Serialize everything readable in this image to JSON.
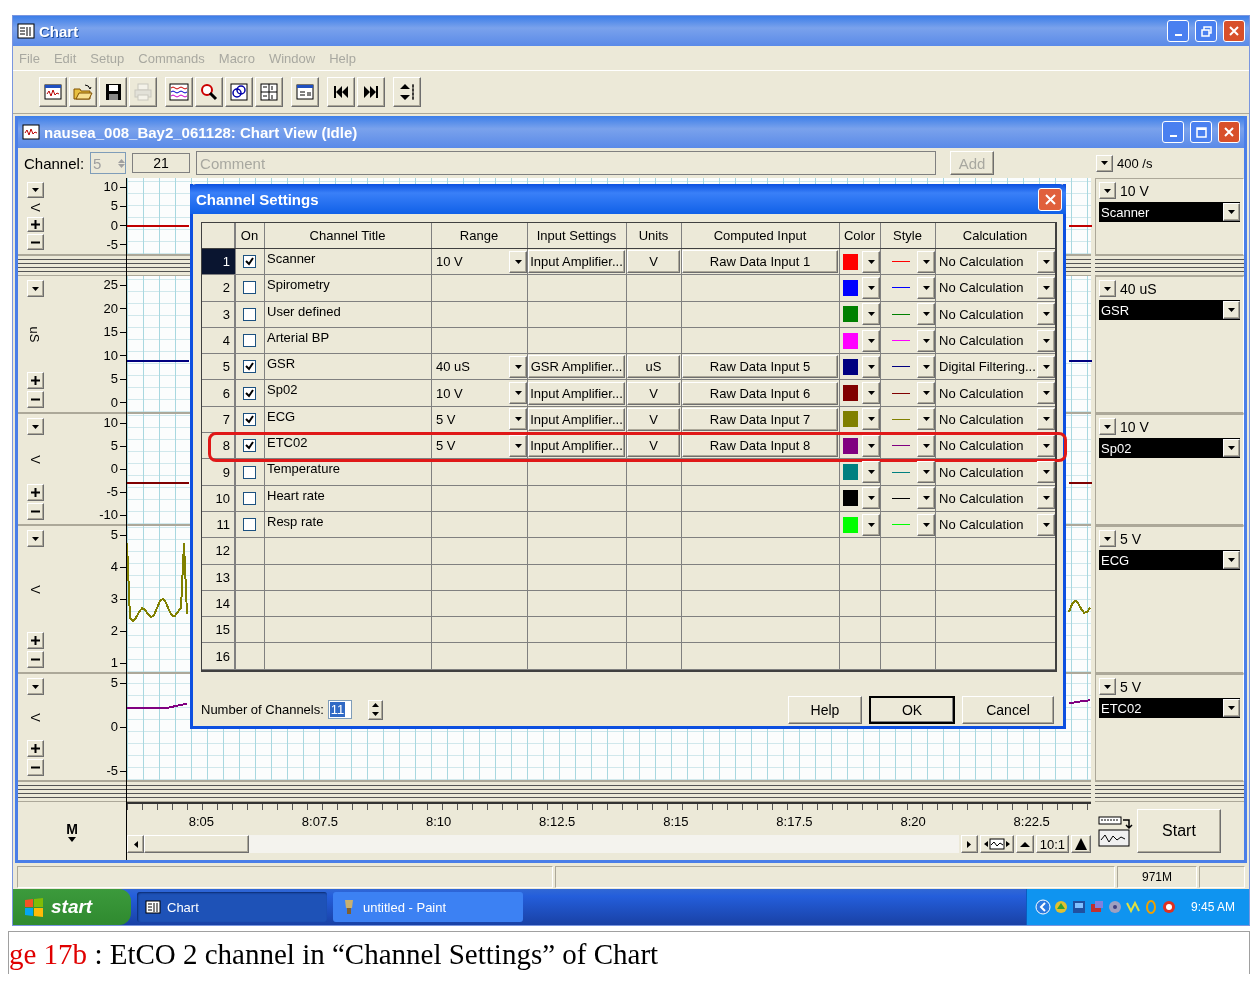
{
  "window": {
    "title": "Chart"
  },
  "menu": [
    {
      "label": "File",
      "disabled": true
    },
    {
      "label": "Edit",
      "disabled": true
    },
    {
      "label": "Setup",
      "disabled": true
    },
    {
      "label": "Commands",
      "disabled": true
    },
    {
      "label": "Macro",
      "disabled": true
    },
    {
      "label": "Window",
      "disabled": true
    },
    {
      "label": "Help",
      "disabled": true
    }
  ],
  "toolbar": [
    {
      "kind": "chart",
      "disabled": false
    },
    {
      "kind": "open",
      "disabled": false
    },
    {
      "kind": "save",
      "disabled": false
    },
    {
      "kind": "print",
      "disabled": true
    },
    {
      "kind": "display",
      "disabled": false
    },
    {
      "kind": "zoom",
      "disabled": false
    },
    {
      "kind": "scope",
      "disabled": false
    },
    {
      "kind": "table",
      "disabled": false
    },
    {
      "kind": "calc",
      "disabled": false
    },
    {
      "kind": "first",
      "disabled": false
    },
    {
      "kind": "last",
      "disabled": false
    },
    {
      "kind": "scale",
      "disabled": false
    }
  ],
  "chart_view": {
    "title": "nausea_008_Bay2_061128: Chart View (Idle)",
    "channel_label": "Channel:",
    "channel_value": "5",
    "channel_disabled": true,
    "counter": "21",
    "comment_placeholder": "Comment",
    "add_button": "Add",
    "add_disabled": true,
    "rate": "400 /s",
    "strips": [
      {
        "unit": "V",
        "ticks": [
          "10",
          "5",
          "0",
          "-5"
        ],
        "range": "10 V",
        "channel": "Scanner",
        "color": "#c00000",
        "kind": "flat"
      },
      {
        "unit": "uS",
        "ticks": [
          "25",
          "20",
          "15",
          "10",
          "5",
          "0"
        ],
        "range": "40 uS",
        "channel": "GSR",
        "color": "#000080",
        "kind": "flat"
      },
      {
        "unit": "V",
        "ticks": [
          "10",
          "5",
          "0",
          "-5",
          "-10"
        ],
        "range": "10 V",
        "channel": "Sp02",
        "color": "#800000",
        "kind": "flat"
      },
      {
        "unit": "V",
        "ticks": [
          "5",
          "4",
          "3",
          "2",
          "1"
        ],
        "range": "5 V",
        "channel": "ECG",
        "color": "#808000",
        "kind": "ecg"
      },
      {
        "unit": "V",
        "ticks": [
          "5",
          "0",
          "-5"
        ],
        "range": "5 V",
        "channel": "ETC02",
        "color": "#800080",
        "kind": "wave"
      }
    ],
    "marker": "M",
    "time_ticks": [
      "8:05",
      "8:07.5",
      "8:10",
      "8:12.5",
      "8:15",
      "8:17.5",
      "8:20",
      "8:22.5"
    ],
    "zoom_ratio": "10:1",
    "start_button": "Start"
  },
  "dialog": {
    "title": "Channel Settings",
    "columns": [
      "On",
      "Channel Title",
      "Range",
      "Input Settings",
      "Units",
      "Computed Input",
      "Color",
      "Style",
      "Calculation"
    ],
    "rows": [
      {
        "number": "1",
        "selected": true,
        "highlighted": false,
        "on": true,
        "title": "Scanner",
        "range": "10 V",
        "input_settings": "Input Amplifier...",
        "units": "V",
        "computed_input": "Raw Data Input 1",
        "color": "#ff0000",
        "calculation": "No Calculation"
      },
      {
        "number": "2",
        "selected": false,
        "highlighted": false,
        "on": false,
        "title": "Spirometry",
        "color": "#0000ff",
        "calculation": "No Calculation"
      },
      {
        "number": "3",
        "selected": false,
        "highlighted": false,
        "on": false,
        "title": "User defined",
        "color": "#008000",
        "calculation": "No Calculation"
      },
      {
        "number": "4",
        "selected": false,
        "highlighted": false,
        "on": false,
        "title": "Arterial BP",
        "color": "#ff00ff",
        "calculation": "No Calculation"
      },
      {
        "number": "5",
        "selected": false,
        "highlighted": false,
        "on": true,
        "title": "GSR",
        "range": "40 uS",
        "input_settings": "GSR Amplifier...",
        "units": "uS",
        "computed_input": "Raw Data Input 5",
        "color": "#000080",
        "calculation": "Digital Filtering..."
      },
      {
        "number": "6",
        "selected": false,
        "highlighted": false,
        "on": true,
        "title": "Sp02",
        "range": "10 V",
        "input_settings": "Input Amplifier...",
        "units": "V",
        "computed_input": "Raw Data Input 6",
        "color": "#800000",
        "calculation": "No Calculation"
      },
      {
        "number": "7",
        "selected": false,
        "highlighted": false,
        "on": true,
        "title": "ECG",
        "range": "5 V",
        "input_settings": "Input Amplifier...",
        "units": "V",
        "computed_input": "Raw Data Input 7",
        "color": "#808000",
        "calculation": "No Calculation"
      },
      {
        "number": "8",
        "selected": false,
        "highlighted": true,
        "on": true,
        "title": "ETC02",
        "range": "5 V",
        "input_settings": "Input Amplifier...",
        "units": "V",
        "computed_input": "Raw Data Input 8",
        "color": "#800080",
        "calculation": "No Calculation"
      },
      {
        "number": "9",
        "selected": false,
        "highlighted": false,
        "on": false,
        "title": "Temperature",
        "color": "#008080",
        "calculation": "No Calculation"
      },
      {
        "number": "10",
        "selected": false,
        "highlighted": false,
        "on": false,
        "title": "Heart rate",
        "color": "#000000",
        "calculation": "No Calculation"
      },
      {
        "number": "11",
        "selected": false,
        "highlighted": false,
        "on": false,
        "title": "Resp rate",
        "color": "#00ff00",
        "calculation": "No Calculation"
      },
      {
        "number": "12",
        "selected": false,
        "highlighted": false
      },
      {
        "number": "13",
        "selected": false,
        "highlighted": false
      },
      {
        "number": "14",
        "selected": false,
        "highlighted": false
      },
      {
        "number": "15",
        "selected": false,
        "highlighted": false
      },
      {
        "number": "16",
        "selected": false,
        "highlighted": false
      }
    ],
    "count_label": "Number of Channels:",
    "count_value": "11",
    "buttons": [
      {
        "label": "Help",
        "focused": false
      },
      {
        "label": "OK",
        "focused": true
      },
      {
        "label": "Cancel",
        "focused": false
      }
    ]
  },
  "status_bar": {
    "memory": "971M"
  },
  "taskbar": {
    "start": "start",
    "tasks": [
      {
        "label": "Chart",
        "selected": true
      },
      {
        "label": "untitled - Paint",
        "selected": false
      }
    ],
    "time": "9:45 AM"
  },
  "caption": {
    "label": "ge 17b",
    "text": ": EtCO 2 channel in “Channel Settings” of Chart"
  }
}
